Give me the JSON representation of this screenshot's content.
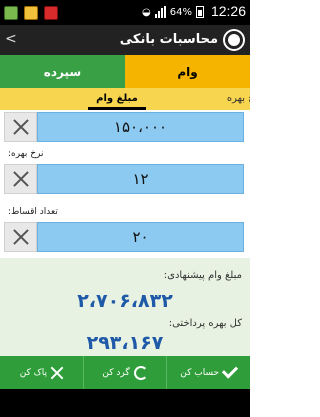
{
  "status_bar": {
    "battery": "64%",
    "time": "12:26"
  },
  "action_bar": {
    "title": "محاسبات بانکی",
    "app_icon": "app-icon",
    "back_icon": "back-chevron-icon"
  },
  "tabs": {
    "deposit": "سپرده",
    "loan": "وام"
  },
  "subtabs": {
    "amount": "مبلغ وام",
    "rate": "نرخ بهره"
  },
  "form": {
    "amount_value": "۱۵۰،۰۰۰",
    "rate_label": "نرخ بهره:",
    "rate_value": "۱۲",
    "installments_label": "تعداد اقساط:",
    "installments_value": "۲۰"
  },
  "results": {
    "suggested_label": "مبلغ وام پیشنهادی:",
    "suggested_value": "۲،۷۰۶،۸۳۲",
    "interest_label": "کل بهره پرداختی:",
    "interest_value": "۲۹۳،۱۶۷"
  },
  "bottom_bar": {
    "calculate": "حساب کن",
    "round": "گرد کن",
    "clear": "پاک کن"
  },
  "colors": {
    "loan_tab": "#f5b400",
    "deposit_tab": "#3aa046",
    "field_bg": "#8dcaf1",
    "result_text": "#1f5aa8",
    "bottom_bar": "#2f9e3a"
  }
}
